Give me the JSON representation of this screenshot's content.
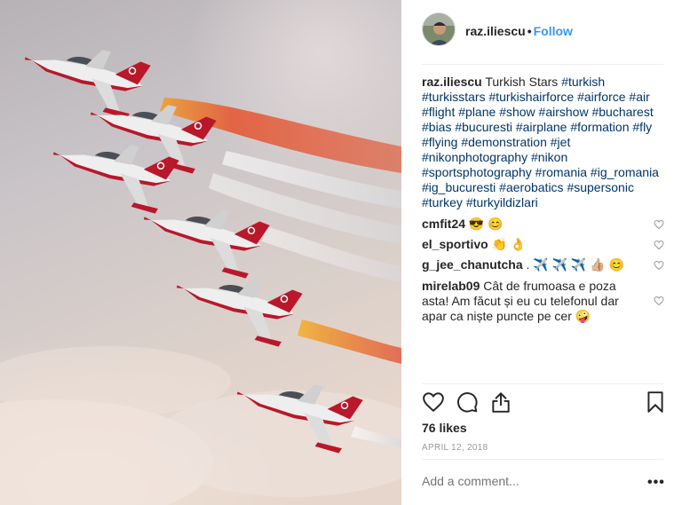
{
  "post": {
    "username": "raz.iliescu",
    "follow_label": "Follow",
    "caption_text": "Turkish Stars",
    "hashtags": [
      "#turkish",
      "#turkisstars",
      "#turkishairforce",
      "#airforce",
      "#air",
      "#flight",
      "#plane",
      "#show",
      "#airshow",
      "#bucharest",
      "#bias",
      "#bucuresti",
      "#airplane",
      "#formation",
      "#fly",
      "#flying",
      "#demonstration",
      "#jet",
      "#nikonphotography",
      "#nikon",
      "#sportsphotography",
      "#romania",
      "#ig_romania",
      "#ig_bucuresti",
      "#aerobatics",
      "#supersonic",
      "#turkey",
      "#turkyildizlari"
    ],
    "comments": [
      {
        "user": "cmfit24",
        "text": "😎 😊"
      },
      {
        "user": "el_sportivo",
        "text": "👏 👌"
      },
      {
        "user": "g_jee_chanutcha",
        "text": ". ✈️ ✈️ ✈️ 👍🏼 😊"
      },
      {
        "user": "mirelab09",
        "text": "Cât de frumoasa e poza asta! Am făcut și eu cu telefonul dar apar ca niște puncte pe cer 🤪"
      }
    ],
    "likes": "76 likes",
    "date": "APRIL 12, 2018",
    "add_comment_placeholder": "Add a comment...",
    "more_label": "•••"
  },
  "icons": {
    "like": "heart-icon",
    "comment": "comment-icon",
    "share": "share-icon",
    "save": "bookmark-icon",
    "comment_like": "heart-icon",
    "options": "more-options-icon"
  },
  "colors": {
    "link": "#003569",
    "follow": "#3897f0",
    "muted": "#999999",
    "divider": "#efefef"
  }
}
